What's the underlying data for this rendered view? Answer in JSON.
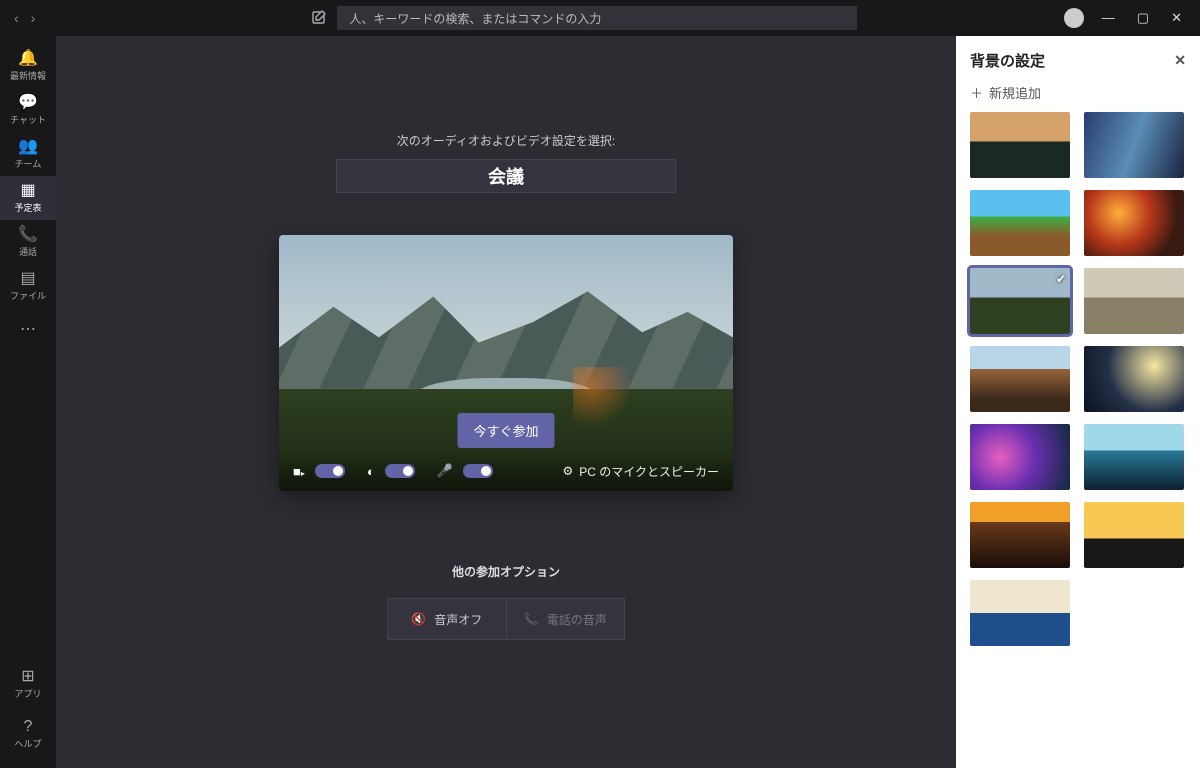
{
  "titlebar": {
    "search_placeholder": "人、キーワードの検索、またはコマンドの入力"
  },
  "leftnav": {
    "items": [
      {
        "label": "最新情報"
      },
      {
        "label": "チャット"
      },
      {
        "label": "チーム"
      },
      {
        "label": "予定表"
      },
      {
        "label": "通話"
      },
      {
        "label": "ファイル"
      }
    ],
    "apps": "アプリ",
    "help": "ヘルプ"
  },
  "meeting": {
    "subtitle": "次のオーディオおよびビデオ設定を選択:",
    "title": "会議",
    "join": "今すぐ参加",
    "pc_audio": "PC のマイクとスピーカー",
    "other_options_title": "他の参加オプション",
    "audio_off": "音声オフ",
    "phone_audio": "電話の音声"
  },
  "panel": {
    "title": "背景の設定",
    "add_new": "新規追加"
  }
}
